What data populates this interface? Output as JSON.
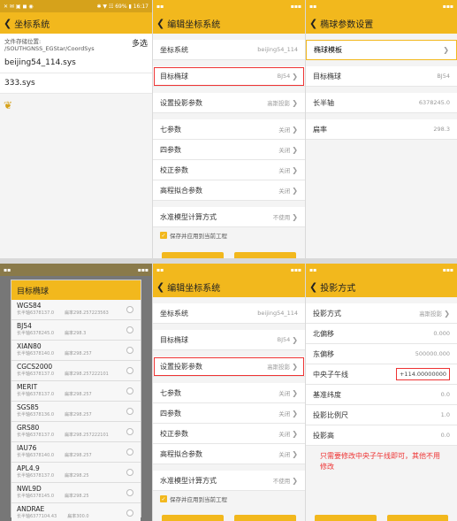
{
  "p1": {
    "status_left": "✕ ✉ ▣ ◼ ◉",
    "status_right": "✱ ▼ ☷ 69% ▮ 16:17",
    "title": "坐标系统",
    "storage_label": "文件存储位置:",
    "storage_path": "/SOUTHGNSS_EGStar/CoordSys",
    "multi_select": "多选",
    "files": [
      "beijing54_114.sys",
      "333.sys"
    ]
  },
  "p2": {
    "title": "编辑坐标系统",
    "rows": [
      {
        "label": "坐标系统",
        "value": "beijing54_114",
        "chevron": false
      },
      {
        "label": "目标椭球",
        "value": "BJ54",
        "chevron": true
      },
      {
        "label": "设置投影参数",
        "value": "高斯投影",
        "chevron": true
      },
      {
        "label": "七参数",
        "value": "关闭",
        "chevron": true
      },
      {
        "label": "四参数",
        "value": "关闭",
        "chevron": true
      },
      {
        "label": "校正参数",
        "value": "关闭",
        "chevron": true
      },
      {
        "label": "高程拟合参数",
        "value": "关闭",
        "chevron": true
      },
      {
        "label": "水准模型计算方式",
        "value": "不使用",
        "chevron": true
      }
    ],
    "save_label": "保存并应用到当前工程"
  },
  "p3": {
    "title": "椭球参数设置",
    "template_label": "椭球模板",
    "rows": [
      {
        "label": "目标椭球",
        "value": "BJ54"
      },
      {
        "label": "长半轴",
        "value": "6378245.0"
      },
      {
        "label": "扁率",
        "value": "298.3"
      }
    ]
  },
  "p4": {
    "title": "目标椭球",
    "ellipsoids": [
      {
        "name": "WGS84",
        "a": "长半轴6378137.0",
        "f": "扁率298.257223563"
      },
      {
        "name": "BJ54",
        "a": "长半轴6378245.0",
        "f": "扁率298.3"
      },
      {
        "name": "XIAN80",
        "a": "长半轴6378140.0",
        "f": "扁率298.257"
      },
      {
        "name": "CGCS2000",
        "a": "长半轴6378137.0",
        "f": "扁率298.257222101"
      },
      {
        "name": "MERIT",
        "a": "长半轴6378137.0",
        "f": "扁率298.257"
      },
      {
        "name": "SGS85",
        "a": "长半轴6378136.0",
        "f": "扁率298.257"
      },
      {
        "name": "GRS80",
        "a": "长半轴6378137.0",
        "f": "扁率298.257222101"
      },
      {
        "name": "IAU76",
        "a": "长半轴6378140.0",
        "f": "扁率298.257"
      },
      {
        "name": "APL4.9",
        "a": "长半轴6378137.0",
        "f": "扁率298.25"
      },
      {
        "name": "NWL9D",
        "a": "长半轴6378145.0",
        "f": "扁率298.25"
      },
      {
        "name": "ANDRAE",
        "a": "长半轴6377104.43",
        "f": "扁率300.0"
      }
    ]
  },
  "p5": {
    "title": "编辑坐标系统",
    "rows": [
      {
        "label": "坐标系统",
        "value": "beijing54_114",
        "chevron": false
      },
      {
        "label": "目标椭球",
        "value": "BJ54",
        "chevron": true
      },
      {
        "label": "设置投影参数",
        "value": "高斯投影",
        "chevron": true
      },
      {
        "label": "七参数",
        "value": "关闭",
        "chevron": true
      },
      {
        "label": "四参数",
        "value": "关闭",
        "chevron": true
      },
      {
        "label": "校正参数",
        "value": "关闭",
        "chevron": true
      },
      {
        "label": "高程拟合参数",
        "value": "关闭",
        "chevron": true
      },
      {
        "label": "水准模型计算方式",
        "value": "不使用",
        "chevron": true
      }
    ],
    "save_label": "保存并应用到当前工程"
  },
  "p6": {
    "title": "投影方式",
    "rows": [
      {
        "label": "投影方式",
        "value": "高斯投影",
        "chevron": true
      },
      {
        "label": "北偏移",
        "value": "0.000"
      },
      {
        "label": "东偏移",
        "value": "500000.000"
      },
      {
        "label": "中央子午线",
        "value": "+114.00000000"
      },
      {
        "label": "基准纬度",
        "value": "0.0"
      },
      {
        "label": "投影比例尺",
        "value": "1.0"
      },
      {
        "label": "投影高",
        "value": "0.0"
      }
    ],
    "note": "只需要修改中央子午线即可，其他不用修改"
  },
  "colors": {
    "accent": "#f2b81d",
    "highlight": "#e33333"
  }
}
